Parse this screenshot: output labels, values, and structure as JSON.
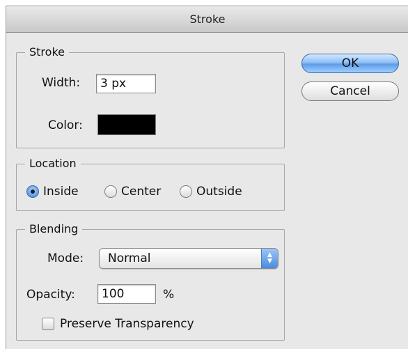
{
  "dialog": {
    "title": "Stroke"
  },
  "stroke": {
    "legend": "Stroke",
    "width_label": "Width:",
    "width_value": "3 px",
    "color_label": "Color:",
    "color_value": "#000000"
  },
  "location": {
    "legend": "Location",
    "options": [
      "Inside",
      "Center",
      "Outside"
    ],
    "selected": "Inside"
  },
  "blending": {
    "legend": "Blending",
    "mode_label": "Mode:",
    "mode_value": "Normal",
    "opacity_label": "Opacity:",
    "opacity_value": "100",
    "opacity_unit": "%",
    "preserve_label": "Preserve Transparency",
    "preserve_checked": false
  },
  "buttons": {
    "ok": "OK",
    "cancel": "Cancel"
  },
  "colors": {
    "accent": "#5f9ce8",
    "dialog_bg": "#e8e8e8"
  },
  "icons": {
    "popup_arrows": "up-down-arrows-icon"
  }
}
